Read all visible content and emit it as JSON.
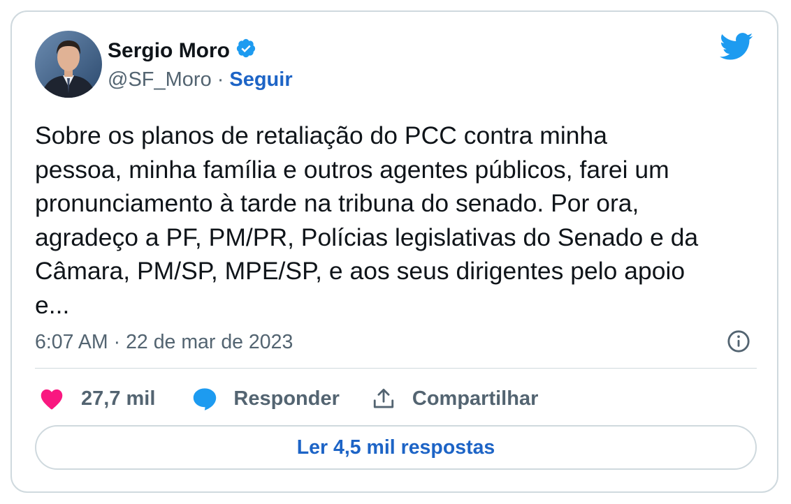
{
  "tweet": {
    "author": {
      "name": "Sergio Moro",
      "handle": "@SF_Moro",
      "separator": "·",
      "follow_label": "Seguir",
      "verified": true,
      "avatar_icon": "author-avatar"
    },
    "text": "Sobre os planos de retaliação do PCC contra minha\npessoa, minha família e outros agentes públicos, farei um\npronunciamento à tarde na tribuna do senado. Por ora,\nagradeço a PF, PM/PR, Polícias legislativas do Senado e da\nCâmara, PM/SP, MPE/SP, e aos seus dirigentes pelo apoio\ne...",
    "time": "6:07 AM",
    "time_separator": "·",
    "date": "22 de mar de 2023",
    "actions": {
      "likes": "27,7 mil",
      "reply_label": "Responder",
      "share_label": "Compartilhar"
    },
    "read_replies_label": "Ler 4,5 mil respostas"
  },
  "icons": {
    "brand": "twitter-bird-icon",
    "verified": "verified-badge-icon",
    "info": "info-icon",
    "like": "heart-icon",
    "reply": "speech-bubble-icon",
    "share": "share-icon"
  },
  "colors": {
    "brand_blue": "#1d9bf0",
    "link_blue": "#1d64c6",
    "like_pink": "#f91880",
    "text_primary": "#0f1419",
    "text_secondary": "#536471",
    "border": "#cfd9de"
  }
}
